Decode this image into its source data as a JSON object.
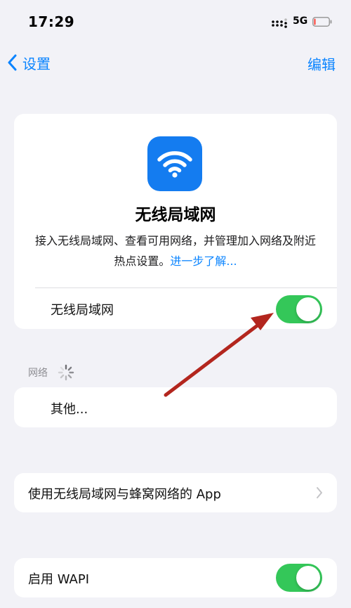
{
  "status_bar": {
    "time": "17:29",
    "network": "5G",
    "battery_level": 0.1,
    "battery_color": "#ff3b30"
  },
  "nav": {
    "back_label": "设置",
    "edit_label": "编辑",
    "accent_color": "#0a84ff"
  },
  "hero": {
    "icon": "wifi-icon",
    "icon_color": "#147cf0",
    "title": "无线局域网",
    "description": "接入无线局域网、查看可用网络，并管理加入网络及附近热点设置。",
    "link": "进一步了解..."
  },
  "wifi_row": {
    "label": "无线局域网",
    "enabled": true,
    "toggle_color": "#34c759"
  },
  "networks": {
    "header": "网络",
    "loading": true,
    "other_label": "其他..."
  },
  "apps_row": {
    "label": "使用无线局域网与蜂窝网络的 App"
  },
  "wapi_row": {
    "label": "启用 WAPI",
    "enabled": true
  },
  "annotation": {
    "arrow_color": "#b3261e"
  }
}
